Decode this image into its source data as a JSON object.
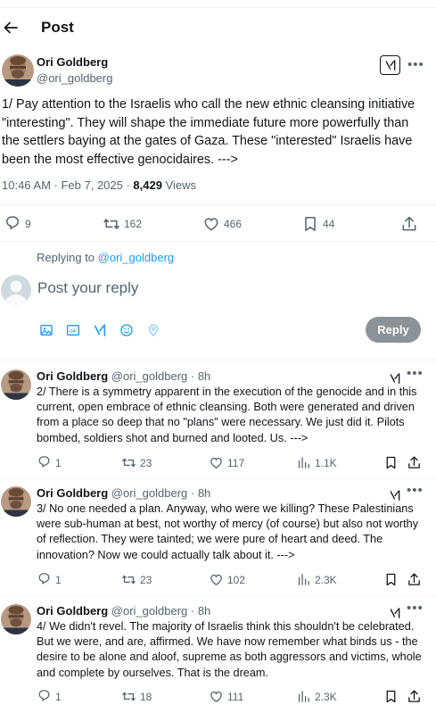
{
  "header": {
    "title": "Post"
  },
  "post": {
    "author": {
      "name": "Ori Goldberg",
      "handle": "@ori_goldberg"
    },
    "text": "1/ Pay attention to the Israelis who call the new ethnic cleansing initiative \"interesting\". They will shape the immediate future more powerfully than the settlers baying at the gates of Gaza. These \"interested\" Israelis have been the most effective genocidaires. --->",
    "time": "10:46 AM · Feb 7, 2025 · ",
    "views_count": "8,429",
    "views_label": " Views",
    "stats": {
      "replies": "9",
      "reposts": "162",
      "likes": "466",
      "bookmarks": "44"
    }
  },
  "compose": {
    "replying_prefix": "Replying to ",
    "replying_handle": "@ori_goldberg",
    "placeholder": "Post your reply",
    "button": "Reply"
  },
  "replies": [
    {
      "name": "Ori Goldberg",
      "handle": "@ori_goldberg · 8h",
      "text": "2/ There is a symmetry apparent in the execution of the genocide and in this current, open embrace of ethnic cleansing. Both were generated and driven from a place so deep that no \"plans\" were necessary. We just did it. Pilots bombed, soldiers shot and burned and looted. Us. --->",
      "stats": {
        "replies": "1",
        "reposts": "23",
        "likes": "117",
        "views": "1.1K"
      }
    },
    {
      "name": "Ori Goldberg",
      "handle": "@ori_goldberg · 8h",
      "text": "3/ No one needed a plan. Anyway, who were we killing? These Palestinians were sub-human at best, not worthy of mercy (of course) but also not worthy of reflection. They were tainted; we were pure of heart and deed. The innovation? Now we could actually talk about it. --->",
      "stats": {
        "replies": "1",
        "reposts": "23",
        "likes": "102",
        "views": "2.3K"
      }
    },
    {
      "name": "Ori Goldberg",
      "handle": "@ori_goldberg · 8h",
      "text": "4/ We didn't revel. The majority of Israelis think this shouldn't be celebrated. But we were, and are, affirmed. We have now remember what binds us - the desire to be alone and aloof, supreme as both aggressors and victims, whole and complete by ourselves. That is the dream.",
      "stats": {
        "replies": "1",
        "reposts": "18",
        "likes": "111",
        "views": "2.3K"
      }
    }
  ],
  "colors": {
    "accent": "#1d9bf0",
    "muted": "#536471",
    "text": "#0f1419",
    "reply_button": "#8b9298",
    "divider": "#eff3f4"
  },
  "icons": [
    "back-arrow-icon",
    "grok-icon",
    "more-icon",
    "reply-icon",
    "repost-icon",
    "like-icon",
    "bookmark-icon",
    "share-icon",
    "views-icon",
    "image-icon",
    "gif-icon",
    "location-icon",
    "emoji-icon"
  ]
}
